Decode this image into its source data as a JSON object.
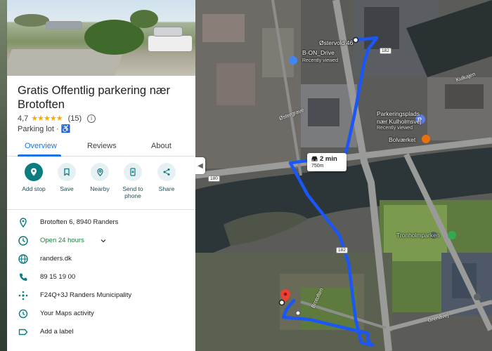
{
  "place": {
    "title": "Gratis Offentlig parkering nær Brotoften",
    "rating": "4,7",
    "stars": "★★★★★",
    "review_count": "(15)",
    "category": "Parking lot ·"
  },
  "tabs": [
    {
      "label": "Overview",
      "active": true
    },
    {
      "label": "Reviews",
      "active": false
    },
    {
      "label": "About",
      "active": false
    }
  ],
  "actions": [
    {
      "label": "Add stop",
      "icon": "add-location-icon"
    },
    {
      "label": "Save",
      "icon": "bookmark-icon"
    },
    {
      "label": "Nearby",
      "icon": "nearby-icon"
    },
    {
      "label": "Send to phone",
      "label_line1": "Send to",
      "label_line2": "phone",
      "icon": "send-to-phone-icon"
    },
    {
      "label": "Share",
      "icon": "share-icon"
    }
  ],
  "details": {
    "address": "Brotoften 6, 8940 Randers",
    "hours": "Open 24 hours",
    "website": "randers.dk",
    "phone": "89 15 19 00",
    "plus_code": "F24Q+3J Randers Municipality",
    "activity": "Your Maps activity",
    "add_label": "Add a label"
  },
  "map": {
    "labels": {
      "destination_address": "Østervold 46",
      "bon_drive": "B-ON_Drive",
      "recently_viewed_1": "Recently viewed",
      "parking_name_1": "Parkeringsplads",
      "parking_name_2": "nær Kulholmsvej",
      "recently_viewed_2": "Recently viewed",
      "bolvaerket": "Bolværket",
      "tronholmparken": "Tronholmparken",
      "kulkajen": "Kulkajen",
      "ostergrave": "Østergrave",
      "brotoften": "Brotoften",
      "grenaavej": "Grenåvej",
      "road_182_a": "182",
      "road_182_b": "182",
      "road_180": "180"
    },
    "route": {
      "duration": "2 min",
      "distance": "750m"
    },
    "colors": {
      "route": "#1a57f5",
      "pin": "#ea4335",
      "accent": "#1a73e8"
    }
  }
}
